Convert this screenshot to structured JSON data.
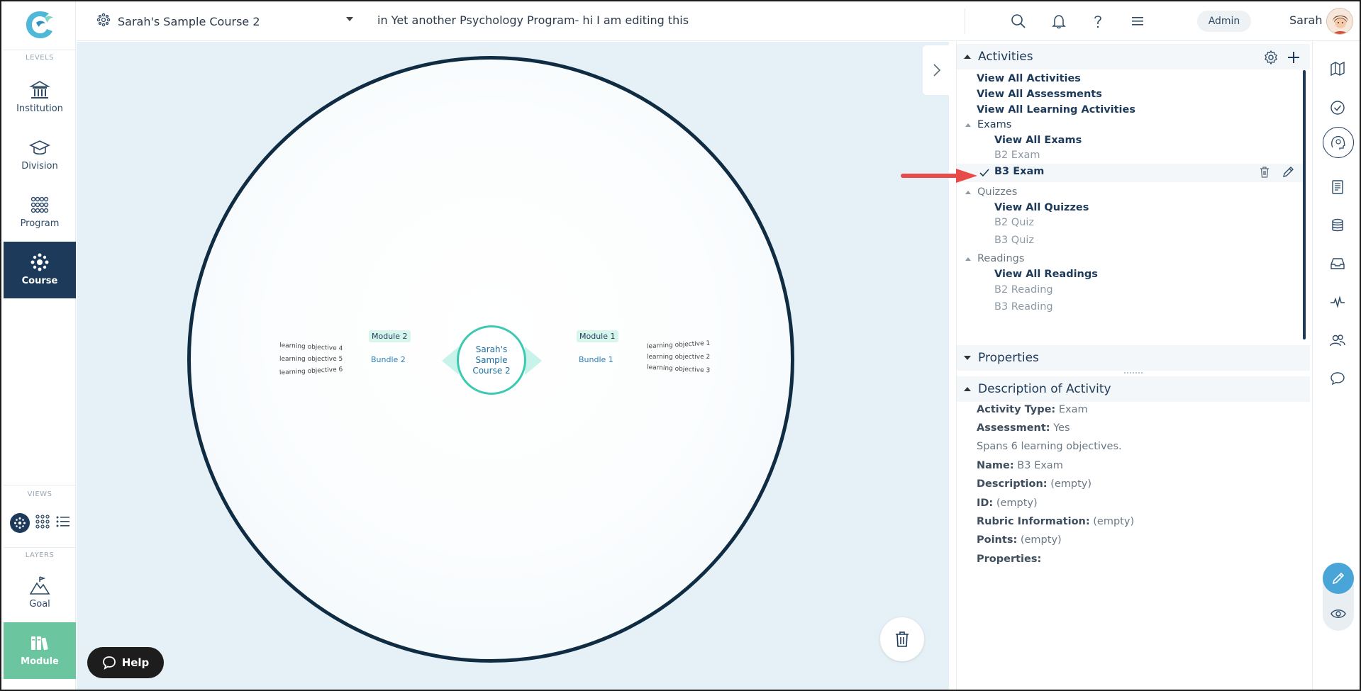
{
  "sidebar": {
    "levels_label": "LEVELS",
    "views_label": "VIEWS",
    "layers_label": "LAYERS",
    "items": {
      "institution": "Institution",
      "division": "Division",
      "program": "Program",
      "course": "Course",
      "goal": "Goal",
      "module": "Module"
    }
  },
  "header": {
    "course_name": "Sarah's Sample Course 2",
    "program_text": "in Yet another Psychology Program- hi I am editing this",
    "admin_label": "Admin",
    "user_name": "Sarah"
  },
  "canvas": {
    "center_node": "Sarah's Sample Course 2",
    "module_left": "Module 2",
    "bundle_left": "Bundle 2",
    "module_right": "Module 1",
    "bundle_right": "Bundle 1",
    "objectives_left": [
      "learning objective 4",
      "learning objective 5",
      "learning objective 6"
    ],
    "objectives_right": [
      "learning objective 1",
      "learning objective 2",
      "learning objective 3"
    ]
  },
  "help": {
    "label": "Help"
  },
  "activities": {
    "title": "Activities",
    "view_all_activities": "View All Activities",
    "view_all_assessments": "View All Assessments",
    "view_all_learning": "View All Learning Activities",
    "exams": {
      "label": "Exams",
      "view_all": "View All Exams",
      "items": [
        "B2 Exam",
        "B3 Exam"
      ]
    },
    "quizzes": {
      "label": "Quizzes",
      "view_all": "View All Quizzes",
      "items": [
        "B2 Quiz",
        "B3 Quiz"
      ]
    },
    "readings": {
      "label": "Readings",
      "view_all": "View All Readings",
      "items": [
        "B2 Reading",
        "B3 Reading"
      ]
    }
  },
  "properties": {
    "title": "Properties"
  },
  "description": {
    "title": "Description of Activity",
    "activity_type_label": "Activity Type:",
    "activity_type_value": "Exam",
    "assessment_label": "Assessment:",
    "assessment_value": "Yes",
    "spans": "Spans 6 learning objectives.",
    "name_label": "Name:",
    "name_value": "B3 Exam",
    "description_label": "Description:",
    "description_value": "(empty)",
    "id_label": "ID:",
    "id_value": "(empty)",
    "rubric_label": "Rubric Information:",
    "rubric_value": "(empty)",
    "points_label": "Points:",
    "points_value": "(empty)",
    "properties_label": "Properties:"
  },
  "colors": {
    "primary": "#1d3a5a",
    "accent_teal": "#3cc9b2",
    "module_green": "#6bc6a0",
    "edit_blue": "#49a5d8",
    "arrow_red": "#e84a4a"
  }
}
